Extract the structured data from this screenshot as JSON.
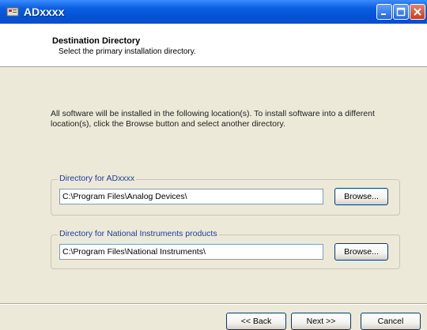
{
  "window": {
    "title": "ADxxxx"
  },
  "header": {
    "title": "Destination Directory",
    "subtitle": "Select the primary installation directory."
  },
  "description": "All software will be installed in the following location(s). To install software into a different location(s), click the Browse button and select another directory.",
  "groups": [
    {
      "label": "Directory for ADxxxx",
      "path": "C:\\Program Files\\Analog Devices\\",
      "browse_label": "Browse..."
    },
    {
      "label": "Directory for National Instruments products",
      "path": "C:\\Program Files\\National Instruments\\",
      "browse_label": "Browse..."
    }
  ],
  "buttons": {
    "back_label": "<< Back",
    "next_label": "Next >>",
    "cancel_label": "Cancel"
  },
  "icons": {
    "app": "installer-icon",
    "minimize": "minimize-icon",
    "maximize": "maximize-icon",
    "close": "close-icon"
  },
  "colors": {
    "titlebar": "#0451d6",
    "close": "#c2401f",
    "group_label": "#1f3c9c",
    "background": "#ece9d8"
  }
}
